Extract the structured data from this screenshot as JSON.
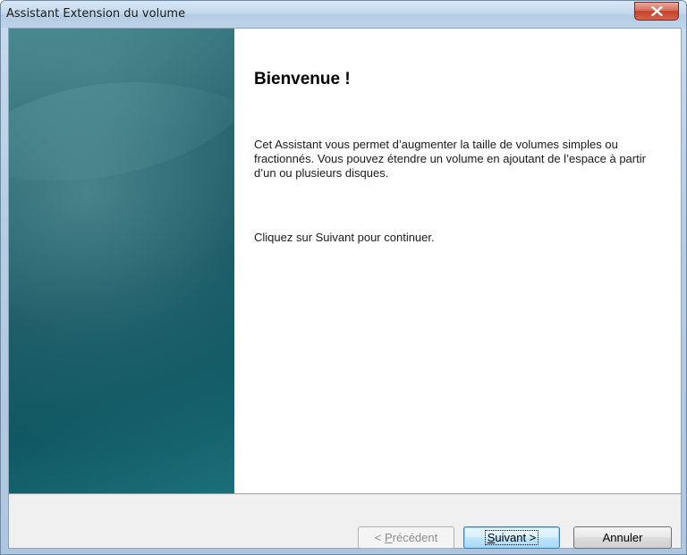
{
  "window": {
    "title": "Assistant Extension du volume"
  },
  "content": {
    "heading": "Bienvenue !",
    "intro": "Cet Assistant vous permet d’augmenter la taille de volumes simples ou fractionnés. Vous pouvez étendre un volume en ajoutant de l’espace à partir d’un ou plusieurs disques.",
    "instruction": "Cliquez sur Suivant pour continuer."
  },
  "buttons": {
    "previous": {
      "prefix": "< ",
      "mnemonic": "P",
      "rest": "récédent",
      "enabled": false
    },
    "next": {
      "mnemonic": "S",
      "rest": "uivant >",
      "is_default": true
    },
    "cancel": "Annuler"
  },
  "icons": {
    "close": "close-icon"
  },
  "colors": {
    "side_panel": "#14545f",
    "close_button": "#c7412a",
    "default_button_border": "#3c7fb1"
  }
}
